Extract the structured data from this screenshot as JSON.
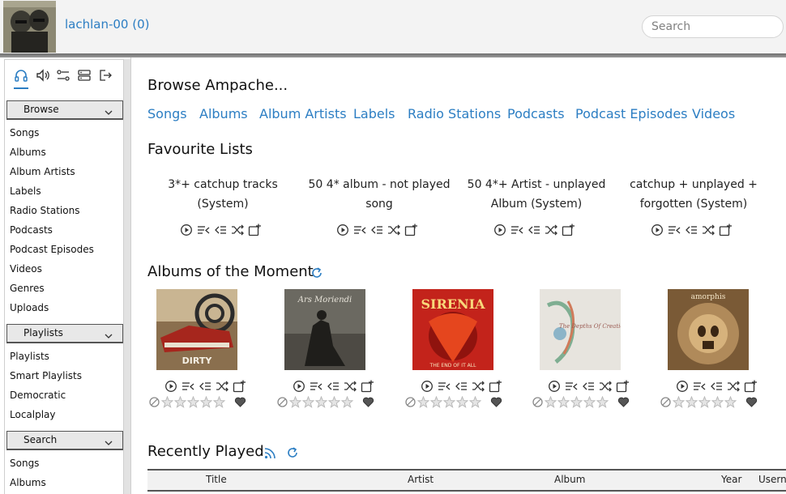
{
  "header": {
    "username": "lachlan-00 (0)",
    "search_placeholder": "Search"
  },
  "sidebar": {
    "tabs": [
      "headphones-icon",
      "speaker-icon",
      "settings-sliders-icon",
      "server-icon",
      "logout-icon"
    ],
    "sections": [
      {
        "title": "Browse",
        "items": [
          "Songs",
          "Albums",
          "Album Artists",
          "Labels",
          "Radio Stations",
          "Podcasts",
          "Podcast Episodes",
          "Videos",
          "Genres",
          "Uploads"
        ]
      },
      {
        "title": "Playlists",
        "items": [
          "Playlists",
          "Smart Playlists",
          "Democratic",
          "Localplay"
        ]
      },
      {
        "title": "Search",
        "items": [
          "Songs",
          "Albums"
        ]
      }
    ]
  },
  "main": {
    "browse_title": "Browse Ampache...",
    "browse_links": [
      "Songs",
      "Albums",
      "Album Artists",
      "Labels",
      "Radio Stations",
      "Podcasts",
      "Podcast Episodes",
      "Videos"
    ],
    "favourites_title": "Favourite Lists",
    "favourites": [
      {
        "name": "3*+ catchup tracks (System)"
      },
      {
        "name": "50 4* album - not played song"
      },
      {
        "name": "50 4*+ Artist - unplayed Album (System)"
      },
      {
        "name": "catchup + unplayed + forgotten (System)"
      }
    ],
    "moment_title": "Albums of the Moment",
    "albums": [
      {
        "cover_text": "DIRTY SMASH ROCK",
        "cover_color": "#8a6f4e",
        "rating": 0
      },
      {
        "cover_text": "Ars Moriendi",
        "cover_color": "#4d4a44",
        "rating": 0
      },
      {
        "cover_text": "SIRENIA",
        "cover_color": "#c3231b",
        "rating": 0
      },
      {
        "cover_text": "The Depths Of Creation",
        "cover_color": "#e7e4de",
        "rating": 0
      },
      {
        "cover_text": "amorphis",
        "cover_color": "#7a5a36",
        "rating": 0
      }
    ],
    "recent_title": "Recently Played",
    "recent_columns": [
      "Title",
      "Artist",
      "Album",
      "Year",
      "Usern"
    ]
  },
  "colors": {
    "accent": "#2c7ec3",
    "header_bg": "#f3f3f3",
    "section_bg": "#e8e8e8"
  }
}
